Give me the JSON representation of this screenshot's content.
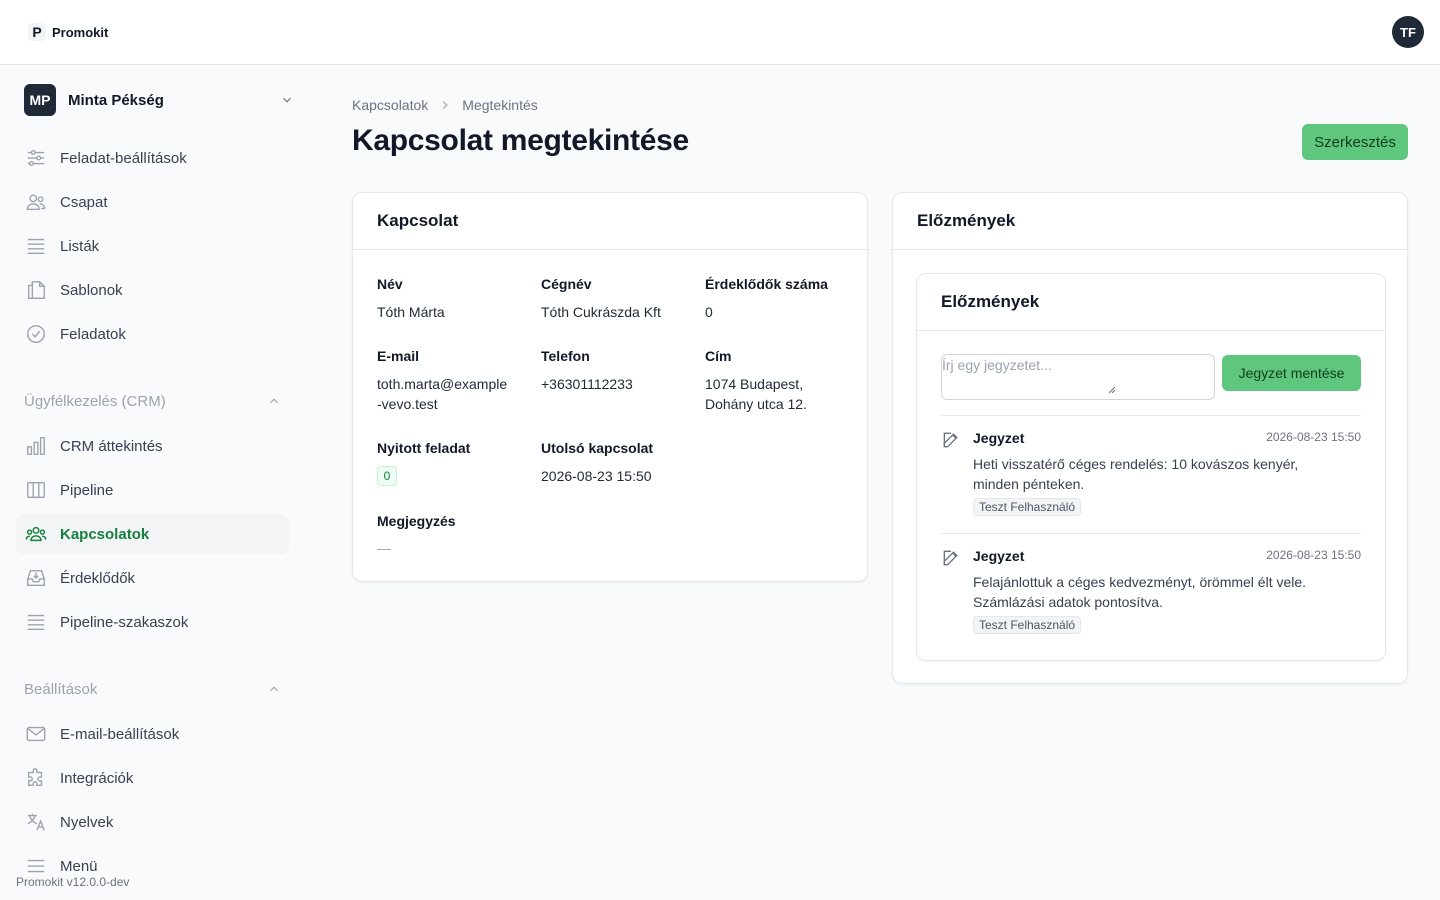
{
  "app": {
    "name": "Promokit",
    "logo_letter": "P",
    "user_initials": "TF",
    "version": "Promokit v12.0.0-dev"
  },
  "workspace": {
    "initials": "MP",
    "name": "Minta Pékség"
  },
  "nav_top": [
    {
      "label": "Feladat-beállítások",
      "icon": "sliders-icon"
    },
    {
      "label": "Csapat",
      "icon": "users-icon"
    },
    {
      "label": "Listák",
      "icon": "list-icon"
    },
    {
      "label": "Sablonok",
      "icon": "documents-icon"
    },
    {
      "label": "Feladatok",
      "icon": "check-circle-icon"
    }
  ],
  "crm_section": {
    "title": "Ügyfélkezelés (CRM)",
    "items": [
      {
        "label": "CRM áttekintés",
        "icon": "bar-chart-icon"
      },
      {
        "label": "Pipeline",
        "icon": "columns-icon"
      },
      {
        "label": "Kapcsolatok",
        "icon": "contacts-icon",
        "active": true
      },
      {
        "label": "Érdeklődők",
        "icon": "inbox-icon"
      },
      {
        "label": "Pipeline-szakaszok",
        "icon": "list-icon"
      }
    ]
  },
  "settings_section": {
    "title": "Beállítások",
    "items": [
      {
        "label": "E-mail-beállítások",
        "icon": "mail-icon"
      },
      {
        "label": "Integrációk",
        "icon": "puzzle-icon"
      },
      {
        "label": "Nyelvek",
        "icon": "translate-icon"
      },
      {
        "label": "Menü",
        "icon": "menu-icon"
      }
    ]
  },
  "breadcrumb": {
    "parent": "Kapcsolatok",
    "current": "Megtekintés"
  },
  "page": {
    "title": "Kapcsolat megtekintése",
    "edit_label": "Szerkesztés"
  },
  "contact_card": {
    "title": "Kapcsolat",
    "name_label": "Név",
    "name": "Tóth Márta",
    "company_label": "Cégnév",
    "company": "Tóth Cukrászda Kft",
    "leads_label": "Érdeklődők száma",
    "leads": "0",
    "email_label": "E-mail",
    "email_line1": "toth.marta@example",
    "email_line2": "-vevo.test",
    "phone_label": "Telefon",
    "phone": "+36301112233",
    "address_label": "Cím",
    "address_line1": "1074 Budapest,",
    "address_line2": "Dohány utca 12.",
    "open_task_label": "Nyitott feladat",
    "open_task": "0",
    "last_contact_label": "Utolsó kapcsolat",
    "last_contact": "2026-08-23 15:50",
    "note_label": "Megjegyzés",
    "note": "—"
  },
  "history_card": {
    "title": "Előzmények",
    "inner_title": "Előzmények",
    "note_placeholder": "Írj egy jegyzetet...",
    "save_label": "Jegyzet mentése",
    "notes": [
      {
        "title": "Jegyzet",
        "time": "2026-08-23 15:50",
        "line1": "Heti visszatérő céges rendelés: 10 kovászos kenyér,",
        "line2": "minden pénteken.",
        "author": "Teszt Felhasználó"
      },
      {
        "title": "Jegyzet",
        "time": "2026-08-23 15:50",
        "line1": "Felajánlottuk a céges kedvezményt, örömmel élt vele.",
        "line2": "Számlázási adatok pontosítva.",
        "author": "Teszt Felhasználó"
      }
    ]
  }
}
